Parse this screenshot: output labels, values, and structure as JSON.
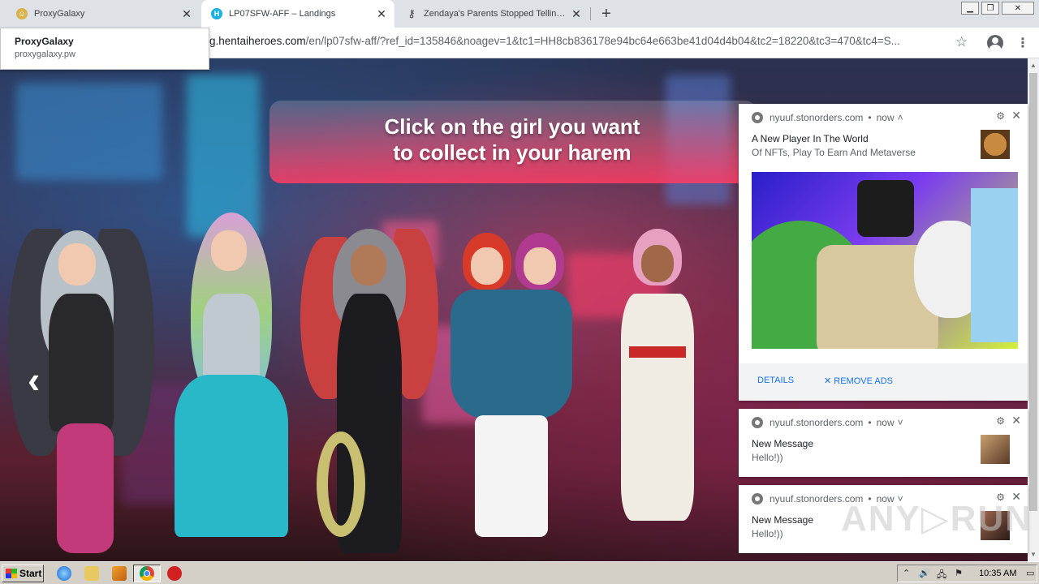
{
  "browser": {
    "tabs": [
      {
        "title": "ProxyGalaxy",
        "active": false
      },
      {
        "title": "LP07SFW-AFF – Landings",
        "active": true
      },
      {
        "title": "Zendaya's Parents Stopped Telling H",
        "active": false
      }
    ],
    "new_tab_label": "+",
    "url_host": "g.hentaiheroes.com",
    "url_path": "/en/lp07sfw-aff/?ref_id=135846&noagev=1&tc1=HH8cb836178e94bc64e663be41d04d4b04&tc2=18220&tc3=470&tc4=S...",
    "tooltip": {
      "title": "ProxyGalaxy",
      "subtitle": "proxygalaxy.pw"
    }
  },
  "page": {
    "headline_line1": "Click on the girl you want",
    "headline_line2": "to collect in your harem",
    "prev_arrow": "‹"
  },
  "notifications": [
    {
      "site": "nyuuf.stonorders.com",
      "time": "now",
      "chevron": "˄",
      "title": "A New Player In The World",
      "body": "Of NFTs, Play To Earn And Metaverse",
      "actions": {
        "details": "DETAILS",
        "remove_ads": "REMOVE ADS"
      }
    },
    {
      "site": "nyuuf.stonorders.com",
      "time": "now",
      "chevron": "˅",
      "title": "New Message",
      "body": "Hello!))"
    },
    {
      "site": "nyuuf.stonorders.com",
      "time": "now",
      "chevron": "˅",
      "title": "New Message",
      "body": "Hello!))"
    }
  ],
  "watermark": "ANY▷RUN",
  "taskbar": {
    "start_label": "Start",
    "clock": "10:35 AM"
  },
  "colors": {
    "banner": "#ff3c64",
    "accent_blue": "#1a73e8",
    "taskbar": "#d4d0c8"
  }
}
